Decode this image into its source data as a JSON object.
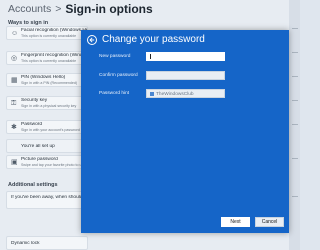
{
  "header": {
    "parent": "Accounts",
    "separator": ">",
    "title": "Sign-in options"
  },
  "ways_title": "Ways to sign in",
  "sign_in_rows": [
    {
      "icon": "face-icon",
      "glyph": "☺",
      "title": "Facial recognition (Windows Hello)",
      "sub": "This option is currently unavailable"
    },
    {
      "icon": "fingerprint-icon",
      "glyph": "◎",
      "title": "Fingerprint recognition (Windows Hello)",
      "sub": "This option is currently unavailable"
    },
    {
      "icon": "pin-icon",
      "glyph": "▦",
      "title": "PIN (Windows Hello)",
      "sub": "Sign in with a PIN (Recommended)"
    },
    {
      "icon": "key-icon",
      "glyph": "⚿",
      "title": "Security key",
      "sub": "Sign in with a physical security key"
    },
    {
      "icon": "password-icon",
      "glyph": "✱",
      "title": "Password",
      "sub": "Sign in with your account's password"
    },
    {
      "icon": "",
      "glyph": "",
      "title": "You're all set up",
      "sub": ""
    },
    {
      "icon": "picture-password-icon",
      "glyph": "▣",
      "title": "Picture password",
      "sub": "Swipe and tap your favorite photo to unlock"
    }
  ],
  "additional_title": "Additional settings",
  "additional_rows": [
    {
      "title": "If you've been away, when should Windows require you to sign in again?",
      "sub": ""
    },
    {
      "title": "Dynamic lock",
      "sub": ""
    }
  ],
  "dialog": {
    "title": "Change your password",
    "fields": [
      {
        "label": "New password",
        "value": ""
      },
      {
        "label": "Confirm password",
        "value": ""
      },
      {
        "label": "Password hint",
        "value": "TheWindowsClub"
      }
    ],
    "next_label": "Next",
    "cancel_label": "Cancel"
  },
  "colors": {
    "dialog_bg": "#1565c8",
    "page_bg": "#e7ecf2"
  }
}
